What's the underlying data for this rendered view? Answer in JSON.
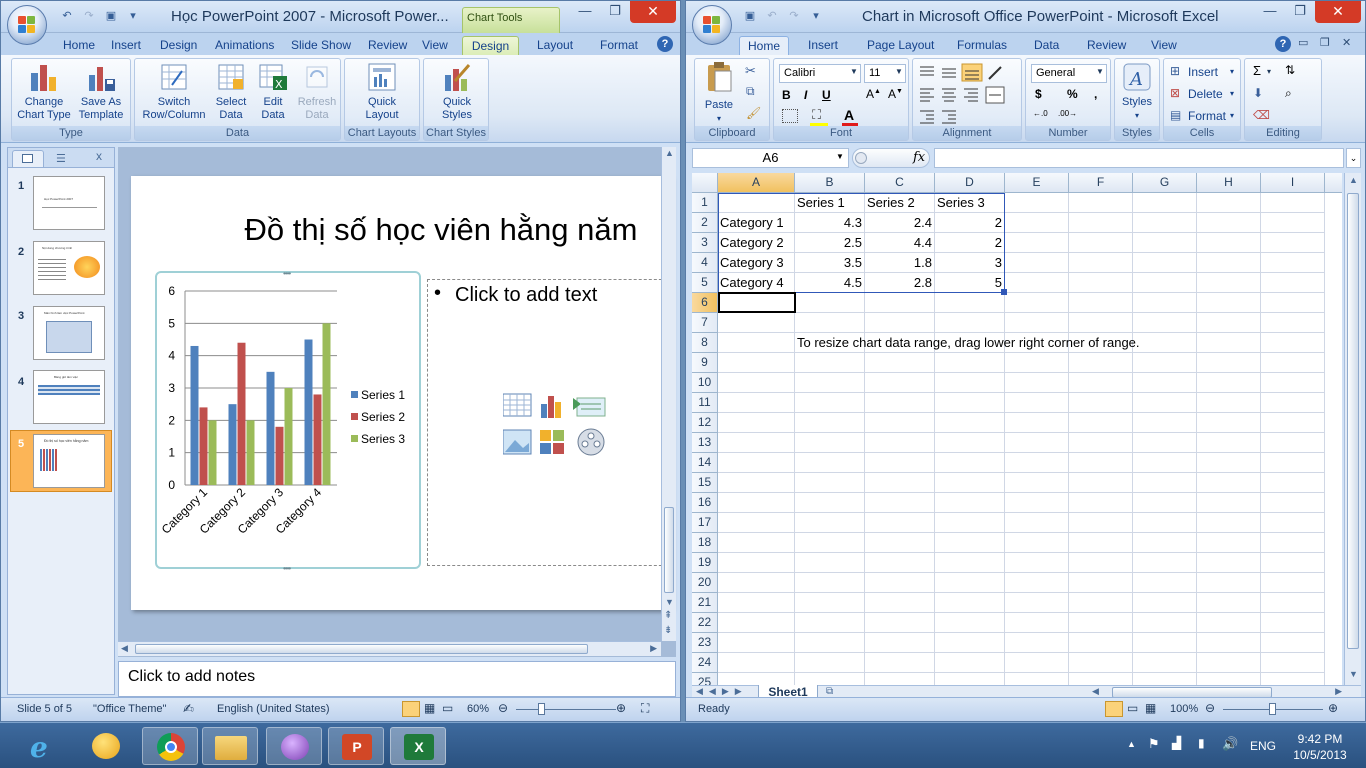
{
  "ppt": {
    "title": "Học PowerPoint 2007 - Microsoft Power...",
    "context_tab": "Chart Tools",
    "tabs": [
      "Home",
      "Insert",
      "Design",
      "Animations",
      "Slide Show",
      "Review",
      "View",
      "Design",
      "Layout",
      "Format"
    ],
    "groups": {
      "type": {
        "label": "Type",
        "change": "Change Chart Type",
        "save": "Save As Template"
      },
      "data": {
        "label": "Data",
        "switch": "Switch Row/Column",
        "select": "Select Data",
        "edit": "Edit Data",
        "refresh": "Refresh Data"
      },
      "layouts": {
        "label": "Chart Layouts",
        "quick": "Quick Layout"
      },
      "styles": {
        "label": "Chart Styles",
        "quick": "Quick Styles"
      }
    },
    "pane_close": "x",
    "slide_numbers": [
      "1",
      "2",
      "3",
      "4",
      "5"
    ],
    "thumb_texts": [
      "Học PowerPoint 2007",
      "Nội dung chương trình",
      "Màn hình làm việc PowerPoint",
      "Bảng giờ làm việc",
      "Đồ thị số học viên hằng năm"
    ],
    "slide": {
      "title": "Đồ thị số học viên hằng năm",
      "placeholder": "Click to add text"
    },
    "notes": "Click to add notes",
    "status": {
      "slide": "Slide 5 of 5",
      "theme": "\"Office Theme\"",
      "language": "English (United States)",
      "zoom": "60%"
    }
  },
  "chart_data": {
    "type": "bar",
    "categories": [
      "Category 1",
      "Category 2",
      "Category 3",
      "Category 4"
    ],
    "series": [
      {
        "name": "Series 1",
        "values": [
          4.3,
          2.5,
          3.5,
          4.5
        ],
        "color": "#4f81bd"
      },
      {
        "name": "Series 2",
        "values": [
          2.4,
          4.4,
          1.8,
          2.8
        ],
        "color": "#c0504d"
      },
      {
        "name": "Series 3",
        "values": [
          2,
          2,
          3,
          5
        ],
        "color": "#9bbb59"
      }
    ],
    "ylim": [
      0,
      6
    ],
    "yticks": [
      "0",
      "1",
      "2",
      "3",
      "4",
      "5",
      "6"
    ],
    "legend": "right",
    "grid": true
  },
  "xl": {
    "title": "Chart in Microsoft Office PowerPoint - Microsoft Excel",
    "tabs": [
      "Home",
      "Insert",
      "Page Layout",
      "Formulas",
      "Data",
      "Review",
      "View"
    ],
    "groups": {
      "clipboard": "Clipboard",
      "font": "Font",
      "alignment": "Alignment",
      "number": "Number",
      "styles": "Styles",
      "cells": "Cells",
      "editing": "Editing"
    },
    "paste": "Paste",
    "font_name": "Calibri",
    "font_size": "11",
    "number_format": "General",
    "insert": "Insert",
    "delete": "Delete",
    "format": "Format",
    "styles_btn": "Styles",
    "name_box": "A6",
    "fx": "fx",
    "columns": [
      "A",
      "B",
      "C",
      "D",
      "E",
      "F",
      "G",
      "H",
      "I"
    ],
    "rows": [
      "1",
      "2",
      "3",
      "4",
      "5",
      "6",
      "7",
      "8",
      "9",
      "10",
      "11",
      "12",
      "13",
      "14",
      "15",
      "16",
      "17",
      "18",
      "19",
      "20",
      "21",
      "22",
      "23",
      "24",
      "25"
    ],
    "header_row": [
      "",
      "Series 1",
      "Series 2",
      "Series 3"
    ],
    "data_rows": [
      [
        "Category 1",
        "4.3",
        "2.4",
        "2"
      ],
      [
        "Category 2",
        "2.5",
        "4.4",
        "2"
      ],
      [
        "Category 3",
        "3.5",
        "1.8",
        "3"
      ],
      [
        "Category 4",
        "4.5",
        "2.8",
        "5"
      ]
    ],
    "note": "To resize chart data range, drag lower right corner of range.",
    "sheet_tab": "Sheet1",
    "status": {
      "ready": "Ready",
      "zoom": "100%"
    }
  },
  "taskbar": {
    "language": "ENG",
    "time": "9:42 PM",
    "date": "10/5/2013"
  }
}
